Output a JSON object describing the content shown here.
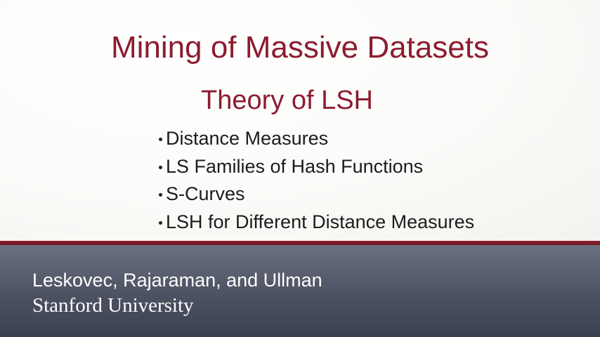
{
  "slide": {
    "title": "Mining of Massive Datasets",
    "subtitle": "Theory of LSH",
    "topics": [
      "Distance Measures",
      "LS Families of Hash Functions",
      "S-Curves",
      "LSH for Different Distance Measures"
    ],
    "authors": "Leskovec, Rajaraman, and Ullman",
    "institution": "Stanford University"
  },
  "colors": {
    "title": "#8c1c2e",
    "divider": "#7a1a27",
    "footer_background": "#4c5262",
    "body_text": "#1c1c1c",
    "footer_text": "#ffffff"
  }
}
